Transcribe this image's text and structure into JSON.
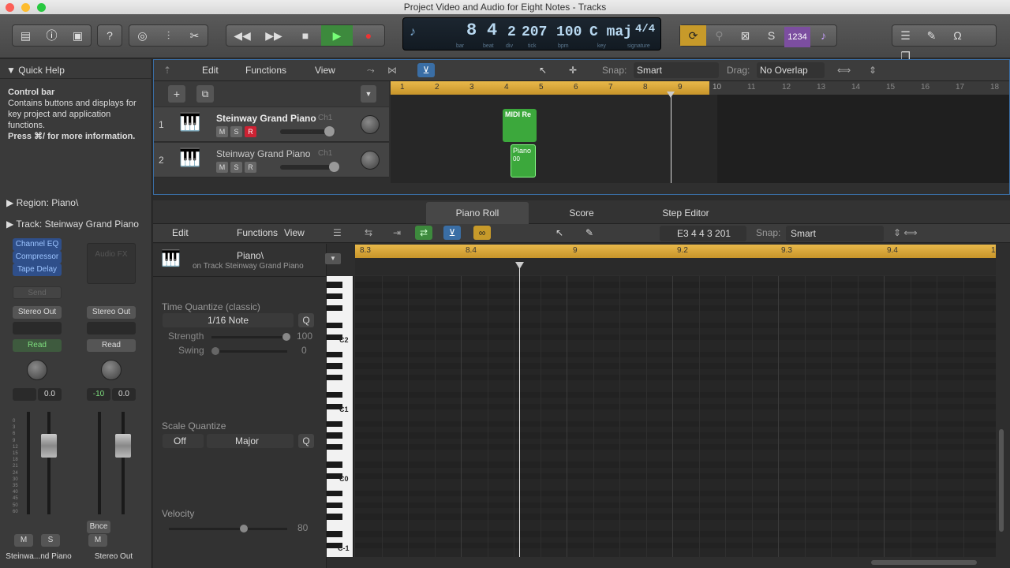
{
  "window": {
    "title": "Project  Video and Audio for Eight Notes - Tracks"
  },
  "lcd": {
    "bar": "8",
    "beat": "4",
    "div": "2",
    "tick": "207",
    "bpm": "100",
    "key": "C maj",
    "signature": "4/4",
    "labels": {
      "bar": "bar",
      "beat": "beat",
      "div": "div",
      "tick": "tick",
      "bpm": "bpm",
      "key": "key",
      "signature": "signature"
    }
  },
  "control": {
    "countin": "1234",
    "solo": "S"
  },
  "quick_help": {
    "heading": "Quick Help",
    "title": "Control bar",
    "body": "Contains buttons and displays for key project and application functions.",
    "hint": "Press ⌘/ for more information."
  },
  "inspector": {
    "region_label": "Region: Piano\\",
    "track_label": "Track:  Steinway Grand Piano",
    "plugins": [
      "Channel EQ",
      "Compressor",
      "Tape Delay"
    ],
    "audio_fx": "Audio FX",
    "send": "Send",
    "output": "Stereo Out",
    "automation_left": "Read",
    "automation_right": "Read",
    "vol_left": "0.0",
    "pan_right": "-10",
    "vol_right": "0.0",
    "bounce": "Bnce",
    "strip_left_m": "M",
    "strip_left_s": "S",
    "strip_right_m": "M",
    "strip_left_name": "Steinwa...nd Piano",
    "strip_right_name": "Stereo Out",
    "scale": [
      "0",
      "3",
      "6",
      "9",
      "12",
      "15",
      "18",
      "21",
      "24",
      "30",
      "35",
      "40",
      "45",
      "50",
      "60"
    ]
  },
  "tracks_toolbar": {
    "edit": "Edit",
    "functions": "Functions",
    "view": "View",
    "snap_label": "Snap:",
    "snap_value": "Smart",
    "drag_label": "Drag:",
    "drag_value": "No Overlap"
  },
  "tracks_ruler": [
    "1",
    "2",
    "3",
    "4",
    "5",
    "6",
    "7",
    "8",
    "9",
    "10",
    "11",
    "12",
    "13",
    "14",
    "15",
    "16",
    "17",
    "18"
  ],
  "tracks": [
    {
      "num": "1",
      "name": "Steinway Grand Piano",
      "ch": "Ch1",
      "m": "M",
      "s": "S",
      "r": "R"
    },
    {
      "num": "2",
      "name": "Steinway Grand Piano",
      "ch": "Ch1",
      "m": "M",
      "s": "S",
      "r": "R"
    }
  ],
  "regions": [
    {
      "label": "MIDI Re"
    },
    {
      "label": "Piano",
      "sub": "00"
    }
  ],
  "editor": {
    "tabs": [
      "Piano Roll",
      "Score",
      "Step Editor"
    ],
    "edit": "Edit",
    "functions": "Functions",
    "view": "View",
    "position": "E3   4 4 3 201",
    "snap_label": "Snap:",
    "snap_value": "Smart",
    "region_name": "Piano\\",
    "region_track": "on Track Steinway Grand Piano",
    "ruler": [
      "8.3",
      "8.4",
      "9",
      "9.2",
      "9.3",
      "9.4",
      "1"
    ],
    "tq_label": "Time Quantize (classic)",
    "tq_value": "1/16 Note",
    "q": "Q",
    "strength_label": "Strength",
    "strength_value": "100",
    "swing_label": "Swing",
    "swing_value": "0",
    "sq_label": "Scale Quantize",
    "sq_off": "Off",
    "sq_major": "Major",
    "velocity_label": "Velocity",
    "velocity_value": "80",
    "octaves": [
      "C2",
      "C1",
      "C0",
      "C-1"
    ]
  }
}
